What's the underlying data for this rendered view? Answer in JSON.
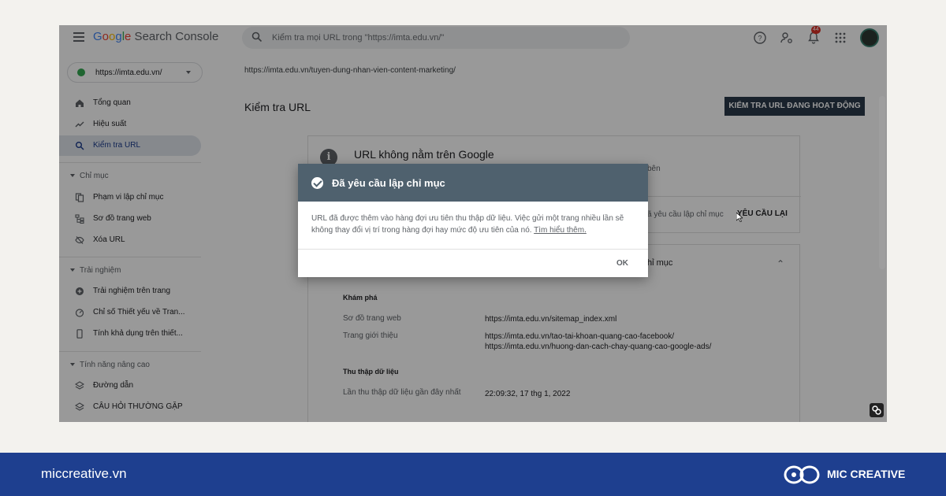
{
  "app": {
    "logo_parts": [
      "G",
      "o",
      "o",
      "g",
      "l",
      "e"
    ],
    "logo_suffix": " Search Console",
    "search_placeholder": "Kiểm tra mọi URL trong \"https://imta.edu.vn/\"",
    "notification_count": "44"
  },
  "sidebar": {
    "property": "https://imta.edu.vn/",
    "items": [
      {
        "label": "Tổng quan",
        "icon": "home-icon"
      },
      {
        "label": "Hiệu suất",
        "icon": "trending-up-icon"
      },
      {
        "label": "Kiểm tra URL",
        "icon": "search-icon"
      }
    ],
    "section_index": "Chỉ mục",
    "index_items": [
      {
        "label": "Phạm vi lập chỉ mục",
        "icon": "file-copy-icon"
      },
      {
        "label": "Sơ đồ trang web",
        "icon": "sitemap-icon"
      },
      {
        "label": "Xóa URL",
        "icon": "eye-off-icon"
      }
    ],
    "section_experience": "Trải nghiệm",
    "experience_items": [
      {
        "label": "Trải nghiệm trên trang",
        "icon": "add-circle-icon"
      },
      {
        "label": "Chỉ số Thiết yếu về Tran...",
        "icon": "speed-icon"
      },
      {
        "label": "Tính khả dụng trên thiết...",
        "icon": "phone-icon"
      }
    ],
    "section_advanced": "Tính năng nâng cao",
    "advanced_items": [
      {
        "label": "Đường dẫn",
        "icon": "layers-icon"
      },
      {
        "label": "CÂU HỎI THƯỜNG GẶP",
        "icon": "layers-icon"
      }
    ]
  },
  "main": {
    "inspected_url": "https://imta.edu.vn/tuyen-dung-nhan-vien-content-marketing/",
    "title": "Kiểm tra URL",
    "live_test_button": "KIỂM TRA URL ĐANG HOẠT ĐỘNG",
    "status_title": "URL không nằm trên Google",
    "status_fragment": "bên",
    "requested_fragment": "ã yêu cầu lập chỉ mục",
    "request_again": "YÊU CẦU LẠI",
    "coverage_fragment": "hỉ mục",
    "discovery_heading": "Khám phá",
    "sitemap_label": "Sơ đồ trang web",
    "sitemap_value": "https://imta.edu.vn/sitemap_index.xml",
    "referring_label": "Trang giới thiệu",
    "referring_values": [
      "https://imta.edu.vn/tao-tai-khoan-quang-cao-facebook/",
      "https://imta.edu.vn/huong-dan-cach-chay-quang-cao-google-ads/"
    ],
    "crawl_heading": "Thu thập dữ liệu",
    "last_crawl_label": "Lần thu thập dữ liệu gần đây nhất",
    "last_crawl_value": "22:09:32, 17 thg 1, 2022"
  },
  "dialog": {
    "title": "Đã yêu cầu lập chỉ mục",
    "body": "URL đã được thêm vào hàng đợi ưu tiên thu thập dữ liệu. Việc gửi một trang nhiều lần sẽ không thay đổi vị trí trong hàng đợi hay mức độ ưu tiên của nó. ",
    "learn_more": "Tìm hiểu thêm.",
    "ok": "OK"
  },
  "footer": {
    "site": "miccreative.vn",
    "brand": "MIC CREATIVE",
    "colors": {
      "band": "#1e3f8f",
      "text": "#ffffff"
    }
  }
}
